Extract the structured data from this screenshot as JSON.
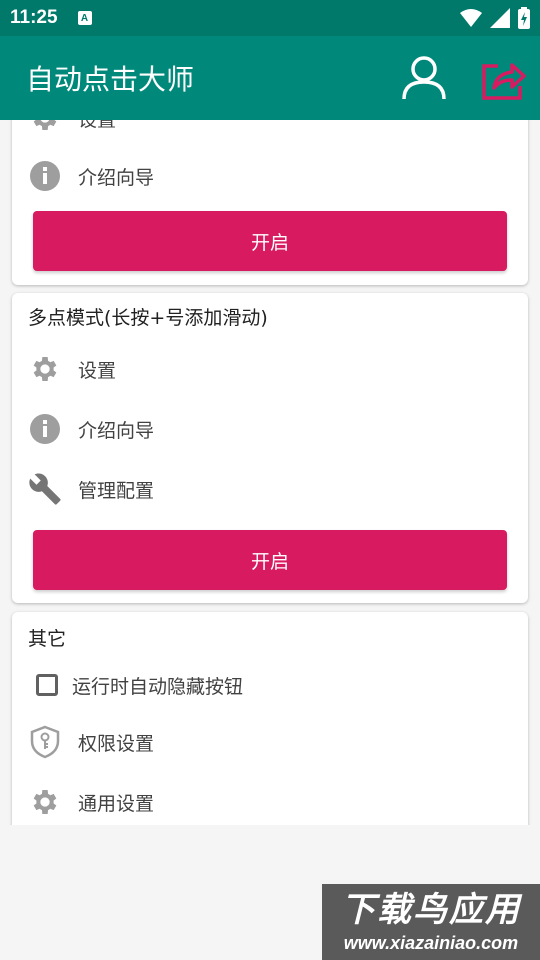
{
  "status_bar": {
    "time": "11:25",
    "notif_icon_text": "A"
  },
  "app_bar": {
    "title": "自动点击大师",
    "icons": {
      "user": "user-icon",
      "share": "share-icon"
    },
    "share_icon_color": "#d81b60",
    "background": "#00897b"
  },
  "card1": {
    "items": [
      {
        "label": "设置",
        "icon": "gear-icon"
      },
      {
        "label": "介绍向导",
        "icon": "info-icon"
      }
    ],
    "start_label": "开启"
  },
  "card2": {
    "title": "多点模式(长按+号添加滑动)",
    "items": [
      {
        "label": "设置",
        "icon": "gear-icon"
      },
      {
        "label": "介绍向导",
        "icon": "info-icon"
      },
      {
        "label": "管理配置",
        "icon": "wrench-icon"
      }
    ],
    "start_label": "开启"
  },
  "card3": {
    "title": "其它",
    "checkbox": {
      "label": "运行时自动隐藏按钮",
      "checked": false
    },
    "items": [
      {
        "label": "权限设置",
        "icon": "shield-key-icon"
      },
      {
        "label": "通用设置",
        "icon": "gear-icon"
      }
    ]
  },
  "watermark": {
    "text": "下载鸟应用",
    "url": "www.xiazainiao.com"
  },
  "accent_color": "#d81b60"
}
